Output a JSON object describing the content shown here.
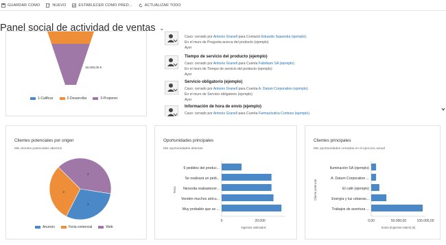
{
  "toolbar": {
    "save_as": "GUARDAR COMO",
    "new": "NUEVO",
    "set_default": "ESTABLECER COMO PRED...",
    "refresh": "ACTUALIZAR TODO"
  },
  "page": {
    "title": "Panel social de actividad de ventas"
  },
  "funnel": {
    "value_label": "18.000,00 €",
    "legend": [
      "1-Calificar",
      "2-Desarrollar",
      "3-Proponer"
    ]
  },
  "feed": {
    "posts": [
      {
        "title": "",
        "pre": "Caso: cerrado por ",
        "user": "Antonio Granell",
        "mid": " para Contacto ",
        "target": "Eduardo Saavedra (ejemplo)",
        "post": ".",
        "wall": "En el muro de Pregunta acerca del producto (ejemplo)",
        "time": "Ayer"
      },
      {
        "title": "Tiempo de servicio del producto (ejemplo)",
        "pre": "Caso: cerrado por ",
        "user": "Antonio Granell",
        "mid": " para Cuenta ",
        "target": "Fabrikam SA (ejemplo)",
        "post": ".",
        "wall": "En el muro de Tiempo de servicio del producto (ejemplo)",
        "time": "Ayer"
      },
      {
        "title": "Servicio obligatorio (ejemplo)",
        "pre": "Caso: cerrado por ",
        "user": "Antonio Granell",
        "mid": " para Cuenta ",
        "target": "A. Datum Corporation (ejemplo)",
        "post": ".",
        "wall": "En el muro de Servicio obligatorio (ejemplo)",
        "time": "Ayer"
      },
      {
        "title": "Información de hora de envío (ejemplo)",
        "pre": "Caso: cerrado por ",
        "user": "Antonio Granell",
        "mid": " para Cuenta ",
        "target": "Farmacéutica Contoso (ejemplo)",
        "post": ".",
        "wall": "",
        "time": ""
      }
    ]
  },
  "leads": {
    "title": "Clientes potenciales por origen",
    "subtitle": "Mis clientes potenciales abiertos"
  },
  "opps": {
    "title": "Oportunidades principales",
    "subtitle": "Mis oportunidades abiertas"
  },
  "clients": {
    "title": "Clientes principales",
    "subtitle": "Mis oportunidades cerradas en el ejercicio actual"
  },
  "colors": {
    "blue": "#4a88c7",
    "orange": "#ef8e39",
    "purple": "#a078a8",
    "link": "#1f6fb2"
  },
  "chart_data": [
    {
      "type": "area",
      "title": "",
      "categories": [
        "1-Calificar",
        "2-Desarrollar",
        "3-Proponer"
      ],
      "annotations": [
        "18.000,00 €"
      ]
    },
    {
      "type": "pie",
      "title": "Clientes potenciales por origen",
      "categories": [
        "Anuncio",
        "Feria comercial",
        "Web"
      ],
      "values": [
        3,
        3,
        4
      ],
      "labels": [
        "3",
        "3",
        "4"
      ]
    },
    {
      "type": "bar",
      "orientation": "horizontal",
      "title": "Oportunidades principales",
      "xlabel": "Ingresos estimados",
      "ylabel": "Tema",
      "categories": [
        "6 pedidos del produc...",
        "Se realizará un pedi...",
        "Necesita reabastecer...",
        "Venden muchos artícu...",
        "Muy probable que se ..."
      ],
      "values": [
        10000,
        25000,
        25000,
        26000,
        30000
      ],
      "xlim": [
        0,
        32000
      ],
      "ticks": [
        "0",
        "20.000"
      ]
    },
    {
      "type": "bar",
      "orientation": "horizontal",
      "title": "Clientes principales",
      "xlabel": "Suma (Ingresos reales) (€)",
      "ylabel": "Cliente potencial",
      "categories": [
        "Iluminación SA (ejemplo)",
        "A. Datum Corporation ...",
        "El café (ejemplo)",
        "Energía y luz urbanas...",
        "Trabajos de aventura ..."
      ],
      "values": [
        9000,
        9000,
        15000,
        28000,
        95000
      ],
      "xlim": [
        0,
        100000
      ],
      "ticks": [
        "0,00",
        "50.000,00",
        "100.000,00"
      ]
    }
  ]
}
